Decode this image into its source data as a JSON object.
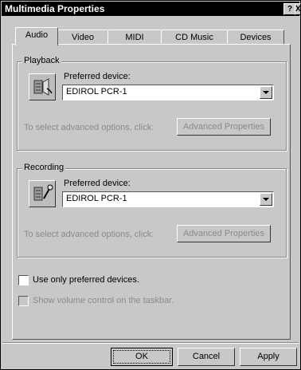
{
  "window": {
    "title": "Multimedia Properties",
    "help_btn": "?",
    "close_btn": "X"
  },
  "tabs": [
    "Audio",
    "Video",
    "MIDI",
    "CD Music",
    "Devices"
  ],
  "playback": {
    "group_label": "Playback",
    "preferred_label": "Preferred device:",
    "device": "EDIROL PCR-1",
    "hint": "To select advanced options, click:",
    "advanced_button": "Advanced Properties",
    "icon": "speaker-device-icon"
  },
  "recording": {
    "group_label": "Recording",
    "preferred_label": "Preferred device:",
    "device": "EDIROL PCR-1",
    "hint": "To select advanced options, click:",
    "advanced_button": "Advanced Properties",
    "icon": "microphone-device-icon"
  },
  "options": {
    "use_preferred": "Use only preferred devices.",
    "show_volume": "Show volume control on the taskbar."
  },
  "buttons": {
    "ok": "OK",
    "cancel": "Cancel",
    "apply": "Apply"
  }
}
